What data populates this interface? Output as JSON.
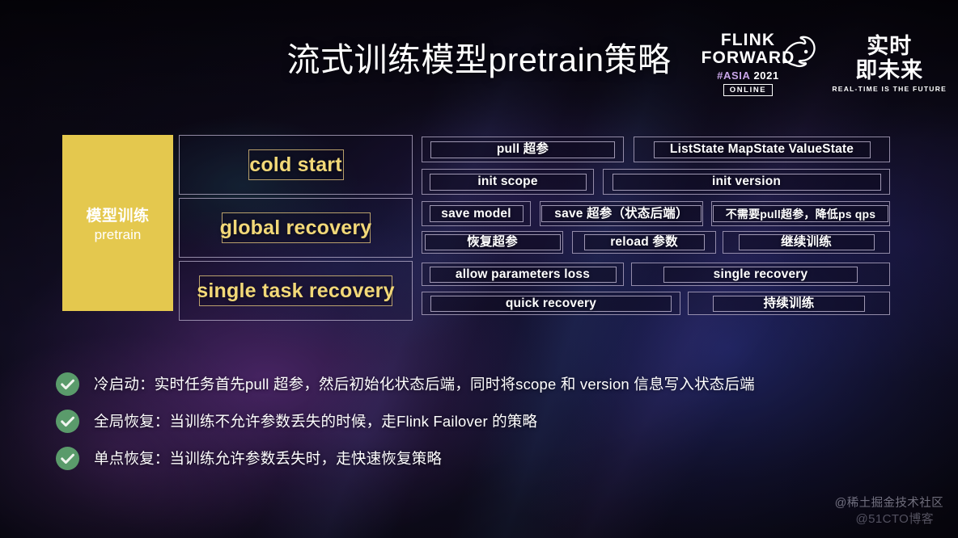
{
  "header": {
    "title": "流式训练模型pretrain策略",
    "logo": {
      "brand_line1": "FLINK",
      "brand_line2": "FORWARD",
      "hash": "#ASIA",
      "year": "2021",
      "online": "ONLINE",
      "cn_line1": "实时",
      "cn_line2": "即未来",
      "tagline": "REAL-TIME IS THE FUTURE",
      "squirrel_icon": "flink-squirrel-icon"
    }
  },
  "diagram": {
    "left_label": {
      "cn": "模型训练",
      "en": "pretrain",
      "bg_color": "#e4c84e"
    },
    "stages": [
      {
        "label": "cold start"
      },
      {
        "label": "global recovery"
      },
      {
        "label": "single task recovery"
      }
    ],
    "steps": [
      {
        "label": "pull 超参"
      },
      {
        "label": "ListState MapState ValueState"
      },
      {
        "label": "init scope"
      },
      {
        "label": "init  version"
      },
      {
        "label": "save model"
      },
      {
        "label": "save 超参（状态后端）"
      },
      {
        "label": "不需要pull超参，降低ps qps"
      },
      {
        "label": "恢复超参"
      },
      {
        "label": "reload 参数"
      },
      {
        "label": "继续训练"
      },
      {
        "label": "allow parameters loss"
      },
      {
        "label": "single recovery"
      },
      {
        "label": "quick recovery"
      },
      {
        "label": "持续训练"
      }
    ]
  },
  "bullets": [
    {
      "text": "冷启动：实时任务首先pull 超参，然后初始化状态后端，同时将scope 和 version 信息写入状态后端"
    },
    {
      "text": "全局恢复：当训练不允许参数丢失的时候，走Flink Failover 的策略"
    },
    {
      "text": "单点恢复：当训练允许参数丢失时，走快速恢复策略"
    }
  ],
  "watermarks": {
    "primary": "@稀土掘金技术社区",
    "secondary": "@51CTO博客"
  },
  "colors": {
    "background": "#0b0817",
    "accent_yellow": "#e4c84e",
    "text_gold": "#f2d878",
    "check_green": "#5a9b6b"
  }
}
